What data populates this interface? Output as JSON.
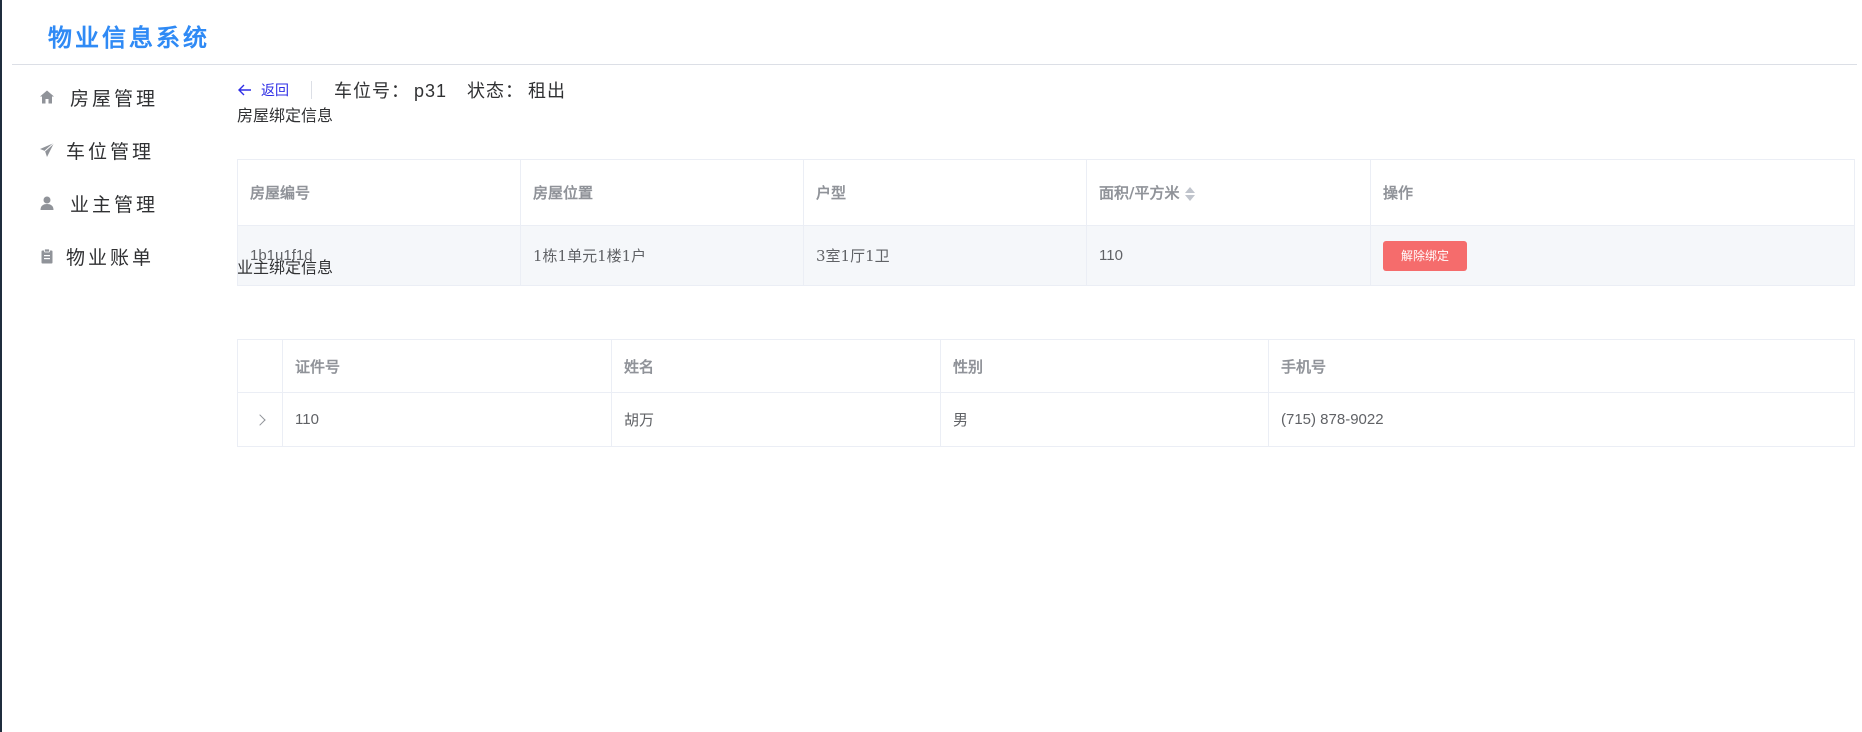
{
  "app": {
    "title": "物业信息系统"
  },
  "sidebar": {
    "items": [
      {
        "label": "房屋管理",
        "icon": "home-icon"
      },
      {
        "label": "车位管理",
        "icon": "paper-plane-icon"
      },
      {
        "label": "业主管理",
        "icon": "user-icon"
      },
      {
        "label": "物业账单",
        "icon": "clipboard-icon"
      }
    ]
  },
  "header": {
    "back_label": "返回",
    "parking_label": "车位号：",
    "parking_value": "p31",
    "status_label": "状态：",
    "status_value": "租出"
  },
  "house_section": {
    "title": "房屋绑定信息",
    "columns": [
      "房屋编号",
      "房屋位置",
      "户型",
      "面积/平方米",
      "操作"
    ],
    "row": {
      "id": "1b1u1f1d",
      "location": "1栋1单元1楼1户",
      "type": "3室1厅1卫",
      "area": "110",
      "action_label": "解除绑定"
    }
  },
  "owner_section": {
    "title": "业主绑定信息",
    "columns": [
      "证件号",
      "姓名",
      "性别",
      "手机号"
    ],
    "row": {
      "id_number": "110",
      "name": "胡万",
      "gender": "男",
      "phone": "(715) 878-9022"
    }
  },
  "colors": {
    "brand": "#2f8af5",
    "danger": "#f56c6c",
    "link": "#2e2ee6"
  }
}
